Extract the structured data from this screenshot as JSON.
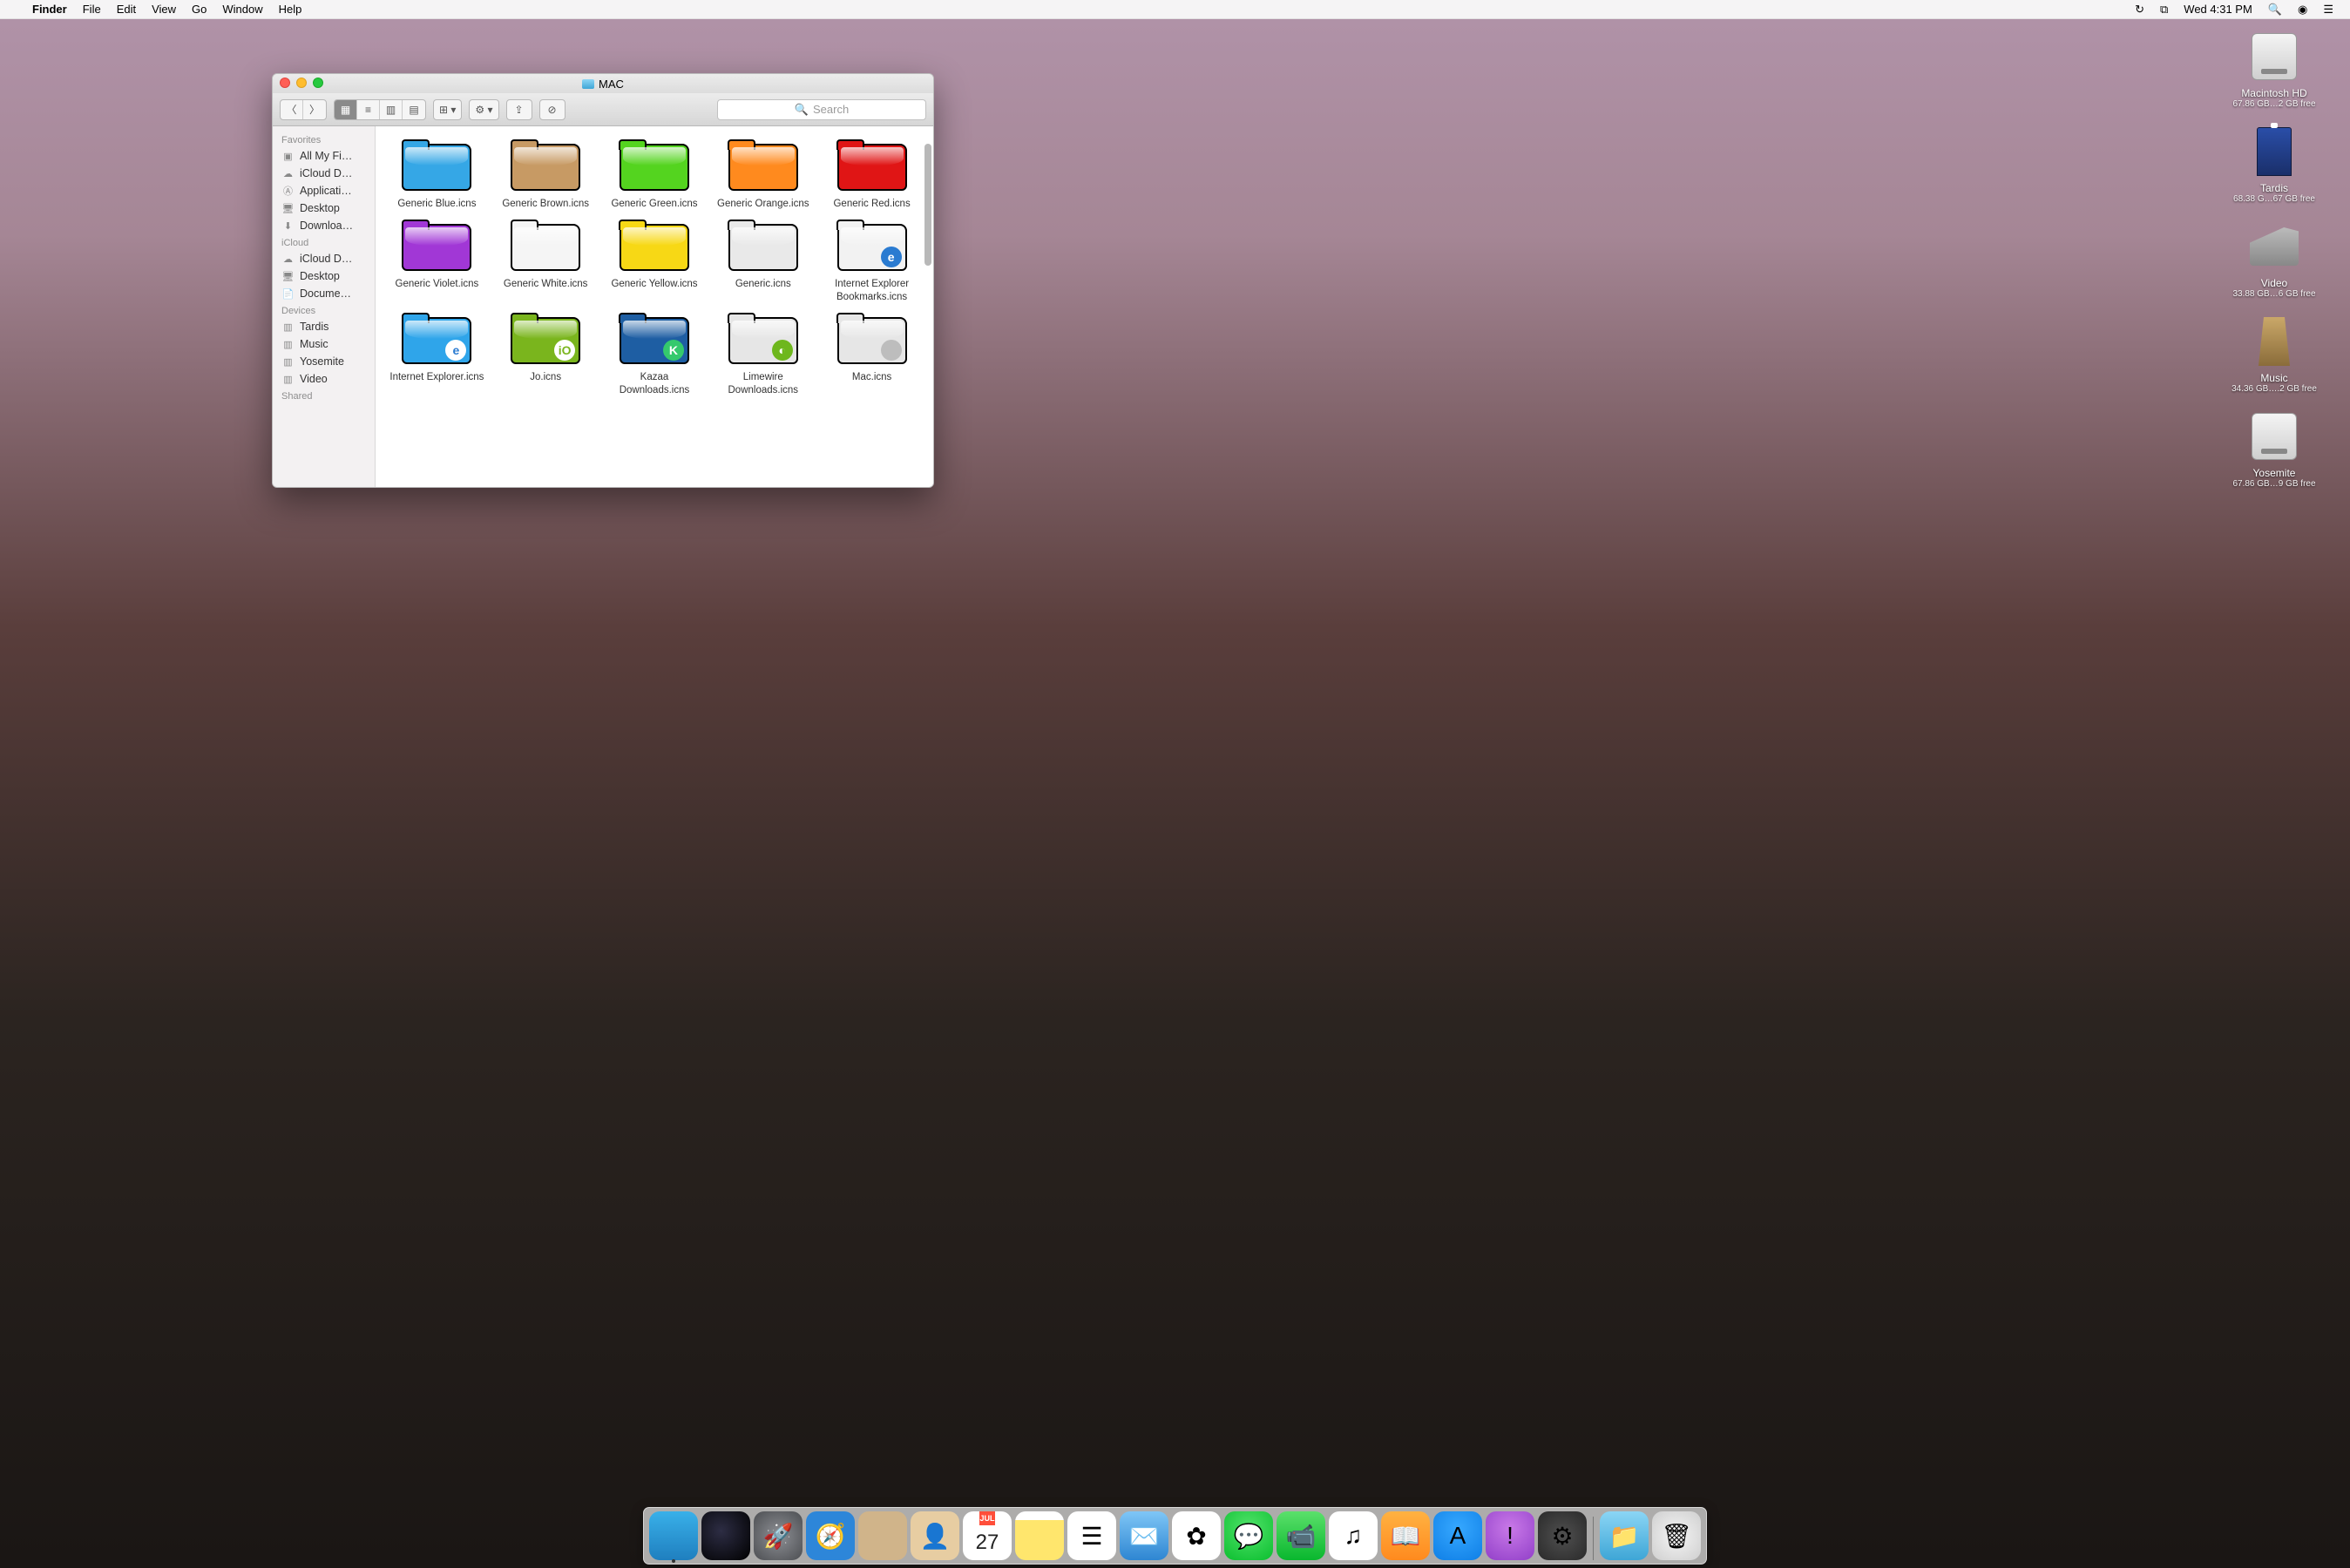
{
  "menubar": {
    "app": "Finder",
    "items": [
      "File",
      "Edit",
      "View",
      "Go",
      "Window",
      "Help"
    ],
    "clock": "Wed 4:31 PM"
  },
  "desktop_icons": [
    {
      "name": "Macintosh HD",
      "sub": "67.86 GB…2 GB free",
      "icon": "hdd"
    },
    {
      "name": "Tardis",
      "sub": "68.38 G…67 GB free",
      "icon": "tardis"
    },
    {
      "name": "Video",
      "sub": "33.88 GB…6 GB free",
      "icon": "k9"
    },
    {
      "name": "Music",
      "sub": "34.36 GB….2 GB free",
      "icon": "dalek"
    },
    {
      "name": "Yosemite",
      "sub": "67.86 GB…9 GB free",
      "icon": "hdd"
    }
  ],
  "finder": {
    "title": "MAC",
    "search_placeholder": "Search",
    "sidebar": {
      "sections": [
        {
          "heading": "Favorites",
          "items": [
            {
              "label": "All My Fi…",
              "icon": "all-my-files"
            },
            {
              "label": "iCloud D…",
              "icon": "icloud"
            },
            {
              "label": "Applicati…",
              "icon": "applications"
            },
            {
              "label": "Desktop",
              "icon": "desktop"
            },
            {
              "label": "Downloa…",
              "icon": "downloads"
            }
          ]
        },
        {
          "heading": "iCloud",
          "items": [
            {
              "label": "iCloud D…",
              "icon": "icloud"
            },
            {
              "label": "Desktop",
              "icon": "desktop"
            },
            {
              "label": "Docume…",
              "icon": "documents"
            }
          ]
        },
        {
          "heading": "Devices",
          "items": [
            {
              "label": "Tardis",
              "icon": "device"
            },
            {
              "label": "Music",
              "icon": "device"
            },
            {
              "label": "Yosemite",
              "icon": "device"
            },
            {
              "label": "Video",
              "icon": "device"
            }
          ]
        },
        {
          "heading": "Shared",
          "items": []
        }
      ]
    },
    "files": [
      {
        "label": "Generic Blue.icns",
        "color": "#35a7e6"
      },
      {
        "label": "Generic Brown.icns",
        "color": "#c79a64"
      },
      {
        "label": "Generic Green.icns",
        "color": "#54d41f"
      },
      {
        "label": "Generic Orange.icns",
        "color": "#ff8a1e"
      },
      {
        "label": "Generic Red.icns",
        "color": "#e01515"
      },
      {
        "label": "Generic Violet.icns",
        "color": "#a137d6"
      },
      {
        "label": "Generic White.icns",
        "color": "#f5f5f5"
      },
      {
        "label": "Generic Yellow.icns",
        "color": "#f7d815"
      },
      {
        "label": "Generic.icns",
        "color": "#e9e9e9"
      },
      {
        "label": "Internet Explorer Bookmarks.icns",
        "color": "#f2f2f2",
        "badge": "e",
        "badge_bg": "#2a7bd1"
      },
      {
        "label": "Internet Explorer.icns",
        "color": "#2fa5ea",
        "badge": "e",
        "badge_bg": "#ffffff",
        "badge_fg": "#2a7bd1"
      },
      {
        "label": "Jo.icns",
        "color": "#7ab51d",
        "badge": "iO",
        "badge_bg": "#ffffff",
        "badge_fg": "#7ab51d"
      },
      {
        "label": "Kazaa Downloads.icns",
        "color": "#1e5ea3",
        "badge": "K",
        "badge_bg": "#35c96d"
      },
      {
        "label": "Limewire Downloads.icns",
        "color": "#e6e6e6",
        "badge": "◐",
        "badge_bg": "#6eb71d"
      },
      {
        "label": "Mac.icns",
        "color": "#e6e6e6",
        "badge": "",
        "badge_bg": "#bdbdbd"
      }
    ]
  },
  "dock": {
    "items": [
      {
        "name": "finder",
        "cls": "dk-finder",
        "indicator": true,
        "glyph": ""
      },
      {
        "name": "siri",
        "cls": "dk-siri",
        "glyph": ""
      },
      {
        "name": "launchpad",
        "cls": "dk-launch",
        "glyph": "🚀"
      },
      {
        "name": "safari",
        "cls": "dk-safari",
        "glyph": "🧭"
      },
      {
        "name": "mission-control",
        "cls": "dk-mission",
        "glyph": ""
      },
      {
        "name": "contacts",
        "cls": "dk-contacts",
        "glyph": "👤"
      },
      {
        "name": "calendar",
        "cls": "dk-cal",
        "glyph": "",
        "month": "JUL",
        "day": "27"
      },
      {
        "name": "notes",
        "cls": "dk-notes",
        "glyph": ""
      },
      {
        "name": "reminders",
        "cls": "dk-remind",
        "glyph": "☰"
      },
      {
        "name": "mail",
        "cls": "dk-mail",
        "glyph": "✉️"
      },
      {
        "name": "photos",
        "cls": "dk-photos",
        "glyph": "✿"
      },
      {
        "name": "messages",
        "cls": "dk-msg",
        "glyph": "💬"
      },
      {
        "name": "facetime",
        "cls": "dk-ft",
        "glyph": "📹"
      },
      {
        "name": "itunes",
        "cls": "dk-itunes",
        "glyph": "♫"
      },
      {
        "name": "ibooks",
        "cls": "dk-ibooks",
        "glyph": "📖"
      },
      {
        "name": "app-store",
        "cls": "dk-appstore",
        "glyph": "A"
      },
      {
        "name": "feedback",
        "cls": "dk-fb",
        "glyph": "!"
      },
      {
        "name": "system-preferences",
        "cls": "dk-sys",
        "glyph": "⚙"
      }
    ],
    "right": [
      {
        "name": "downloads",
        "cls": "dk-dl",
        "glyph": "📁"
      },
      {
        "name": "trash",
        "cls": "dk-trash",
        "glyph": "🗑"
      }
    ]
  }
}
